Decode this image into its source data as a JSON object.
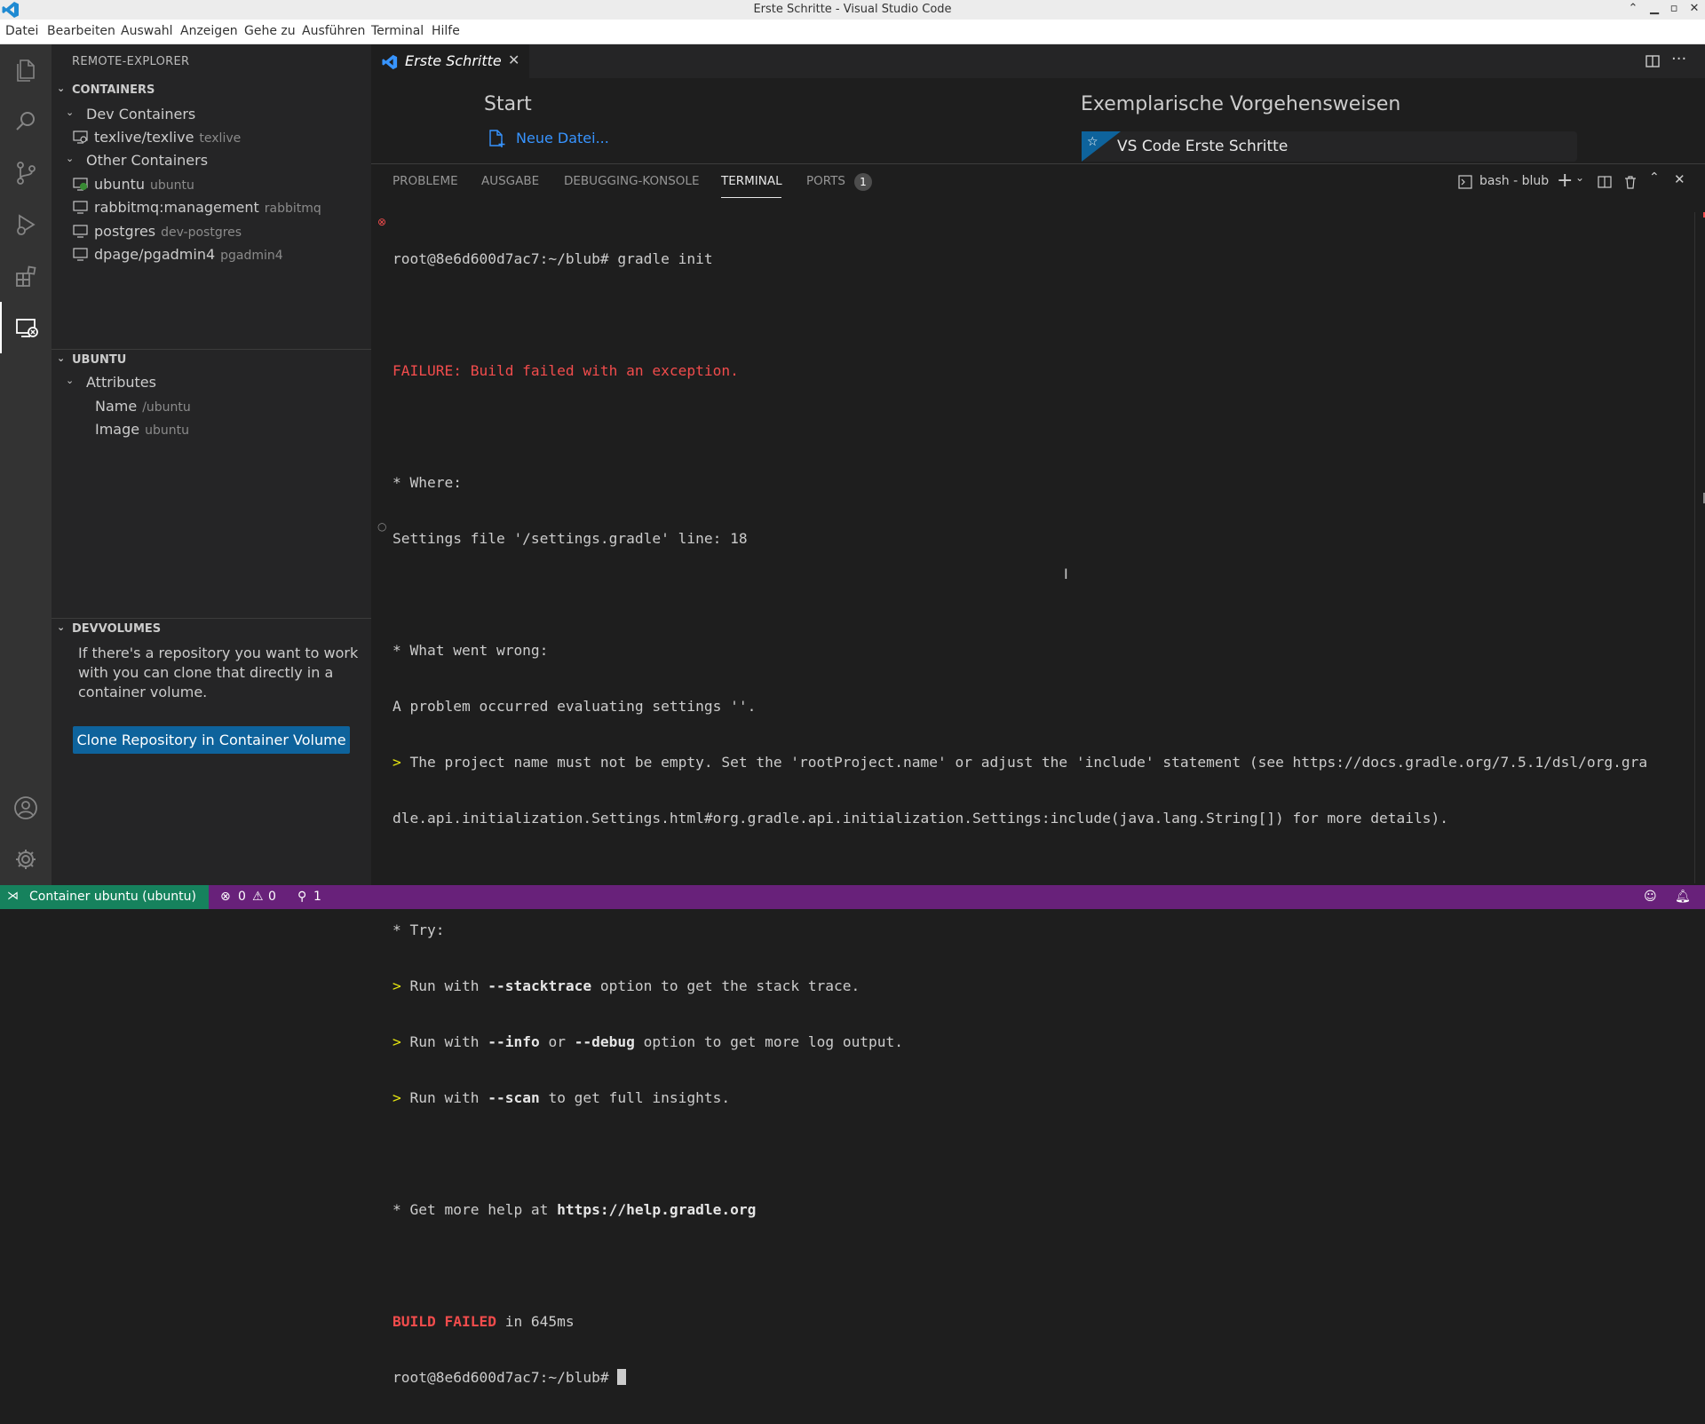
{
  "window": {
    "title": "Erste Schritte - Visual Studio Code"
  },
  "menu": [
    "Datei",
    "Bearbeiten",
    "Auswahl",
    "Anzeigen",
    "Gehe zu",
    "Ausführen",
    "Terminal",
    "Hilfe"
  ],
  "sidebar": {
    "title": "REMOTE-EXPLORER",
    "containers": {
      "header": "CONTAINERS",
      "dev_group": "Dev Containers",
      "dev_items": [
        {
          "name": "texlive/texlive",
          "desc": "texlive"
        }
      ],
      "other_group": "Other Containers",
      "other_items": [
        {
          "name": "ubuntu",
          "desc": "ubuntu"
        },
        {
          "name": "rabbitmq:management",
          "desc": "rabbitmq"
        },
        {
          "name": "postgres",
          "desc": "dev-postgres"
        },
        {
          "name": "dpage/pgadmin4",
          "desc": "pgadmin4"
        }
      ]
    },
    "ubuntu": {
      "header": "UBUNTU",
      "group": "Attributes",
      "attrs": [
        {
          "name": "Name",
          "value": "/ubuntu"
        },
        {
          "name": "Image",
          "value": "ubuntu"
        }
      ]
    },
    "devvolumes": {
      "header": "DEVVOLUMES",
      "text": "If there's a repository you want to work with you can clone that directly in a container volume.",
      "button": "Clone Repository in Container Volume"
    }
  },
  "editor": {
    "tab": "Erste Schritte",
    "start_heading": "Start",
    "new_file": "Neue Datei...",
    "walkthroughs_heading": "Exemplarische Vorgehensweisen",
    "walkthrough_item": "VS Code Erste Schritte"
  },
  "panel": {
    "tabs": [
      "PROBLEME",
      "AUSGABE",
      "DEBUGGING-KONSOLE",
      "TERMINAL",
      "PORTS"
    ],
    "ports_count": "1",
    "terminal_name": "bash - blub"
  },
  "terminal": {
    "l1": "root@8e6d600d7ac7:~/blub# gradle init",
    "l3": "FAILURE: Build failed with an exception.",
    "l5": "* Where:",
    "l6": "Settings file '/settings.gradle' line: 18",
    "l8": "* What went wrong:",
    "l9": "A problem occurred evaluating settings ''.",
    "l10": " The project name must not be empty. Set the 'rootProject.name' or adjust the 'include' statement (see https://docs.gradle.org/7.5.1/dsl/org.gra",
    "l11": "dle.api.initialization.Settings.html#org.gradle.api.initialization.Settings:include(java.lang.String[]) for more details).",
    "l13": "* Try:",
    "try1a": " Run with ",
    "try1b": "--stacktrace",
    "try1c": " option to get the stack trace.",
    "try2a": " Run with ",
    "try2b": "--info",
    "try2c": " or ",
    "try2d": "--debug",
    "try2e": " option to get more log output.",
    "try3a": " Run with ",
    "try3b": "--scan",
    "try3c": " to get full insights.",
    "help_a": "* Get more help at ",
    "help_b": "https://help.gradle.org",
    "failed_a": "BUILD FAILED",
    "failed_b": " in 645ms",
    "prompt": "root@8e6d600d7ac7:~/blub# "
  },
  "status": {
    "remote": "Container ubuntu (ubuntu)",
    "errors": "0",
    "warnings": "0",
    "ports": "1"
  }
}
